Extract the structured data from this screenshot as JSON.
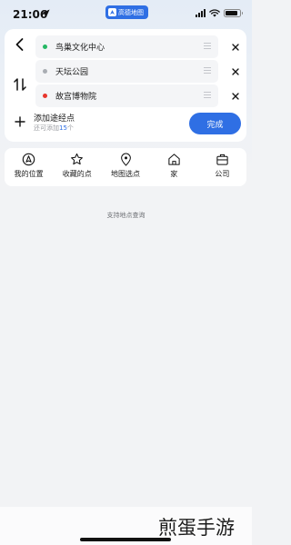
{
  "status_bar": {
    "time": "21:06",
    "app_name": "高德地图",
    "brand_color": "#2f6fe4"
  },
  "route": {
    "stops": [
      {
        "label": "鸟巢文化中心",
        "dot_color": "#25b864"
      },
      {
        "label": "天坛公园",
        "dot_color": "#a9adb3"
      },
      {
        "label": "故宫博物院",
        "dot_color": "#e8362d"
      }
    ],
    "add_waypoint": {
      "title": "添加途经点",
      "subtitle_prefix": "还可添加",
      "subtitle_count": "15",
      "subtitle_suffix": "个"
    },
    "done_label": "完成"
  },
  "shortcuts": [
    {
      "label": "我的位置",
      "icon": "navigation-icon"
    },
    {
      "label": "收藏的点",
      "icon": "star-icon"
    },
    {
      "label": "地图选点",
      "icon": "map-pin-icon"
    },
    {
      "label": "家",
      "icon": "home-icon"
    },
    {
      "label": "公司",
      "icon": "briefcase-icon"
    }
  ],
  "hint": "支持地点查询",
  "watermark": "煎蛋手游"
}
